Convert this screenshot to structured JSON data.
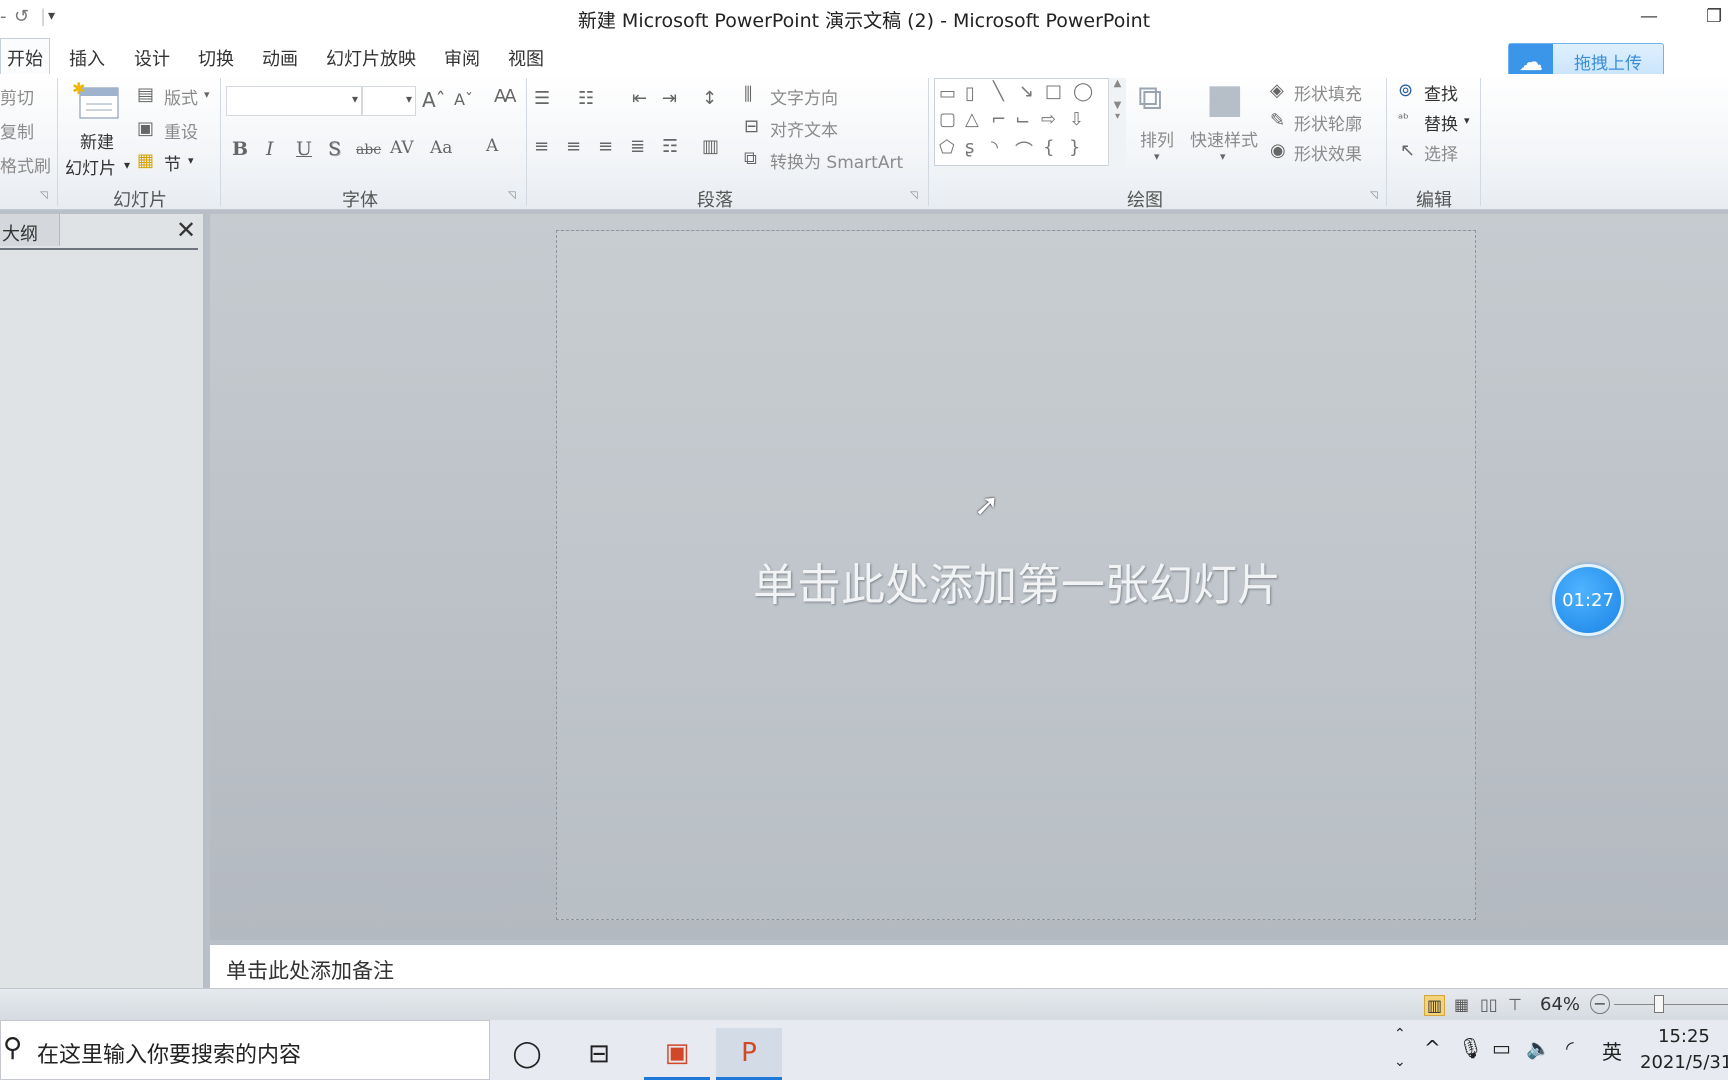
{
  "window": {
    "title": "新建 Microsoft PowerPoint 演示文稿 (2) - Microsoft PowerPoint",
    "minimize_icon": "minimize-icon",
    "restore_icon": "restore-icon"
  },
  "quick_access": {
    "redo_icon": "redo-icon",
    "customize_icon": "dropdown-icon"
  },
  "tabs": [
    "开始",
    "插入",
    "设计",
    "切换",
    "动画",
    "幻灯片放映",
    "审阅",
    "视图"
  ],
  "upload": {
    "label": "拖拽上传",
    "icon": "cloud-icon"
  },
  "ribbon": {
    "clipboard": {
      "cut": "剪切",
      "copy": "复制",
      "format_painter": "格式刷"
    },
    "slides": {
      "new_slide_line1": "新建",
      "new_slide_line2": "幻灯片",
      "layout": "版式",
      "reset": "重设",
      "section": "节",
      "group_label": "幻灯片"
    },
    "font": {
      "group_label": "字体",
      "font_name": "",
      "font_size": "",
      "bold": "B",
      "italic": "I",
      "underline": "U",
      "shadow": "S",
      "strikethrough": "abc",
      "spacing": "AV",
      "change_case": "Aa",
      "font_color": "A"
    },
    "paragraph": {
      "group_label": "段落",
      "text_direction": "文字方向",
      "align_text": "对齐文本",
      "convert_smartart": "转换为 SmartArt"
    },
    "drawing": {
      "group_label": "绘图",
      "arrange": "排列",
      "quick_styles": "快速样式",
      "shape_fill": "形状填充",
      "shape_outline": "形状轮廓",
      "shape_effects": "形状效果"
    },
    "editing": {
      "group_label": "编辑",
      "find": "查找",
      "replace": "替换",
      "select": "选择"
    }
  },
  "left_pane": {
    "tab_label": "大纲",
    "close_icon": "close-icon"
  },
  "slide": {
    "placeholder": "单击此处添加第一张幻灯片"
  },
  "timer": {
    "value": "01:27"
  },
  "notes": {
    "placeholder": "单击此处添加备注"
  },
  "statusbar": {
    "zoom": "64%",
    "zoom_value": 0.64
  },
  "taskbar": {
    "search_placeholder": "在这里输入你要搜索的内容",
    "ime": "英",
    "time": "15:25",
    "date": "2021/5/31"
  },
  "colors": {
    "accent": "#1e78d8",
    "upload_accent": "#3b96ea",
    "timer": "#1a84e6"
  }
}
